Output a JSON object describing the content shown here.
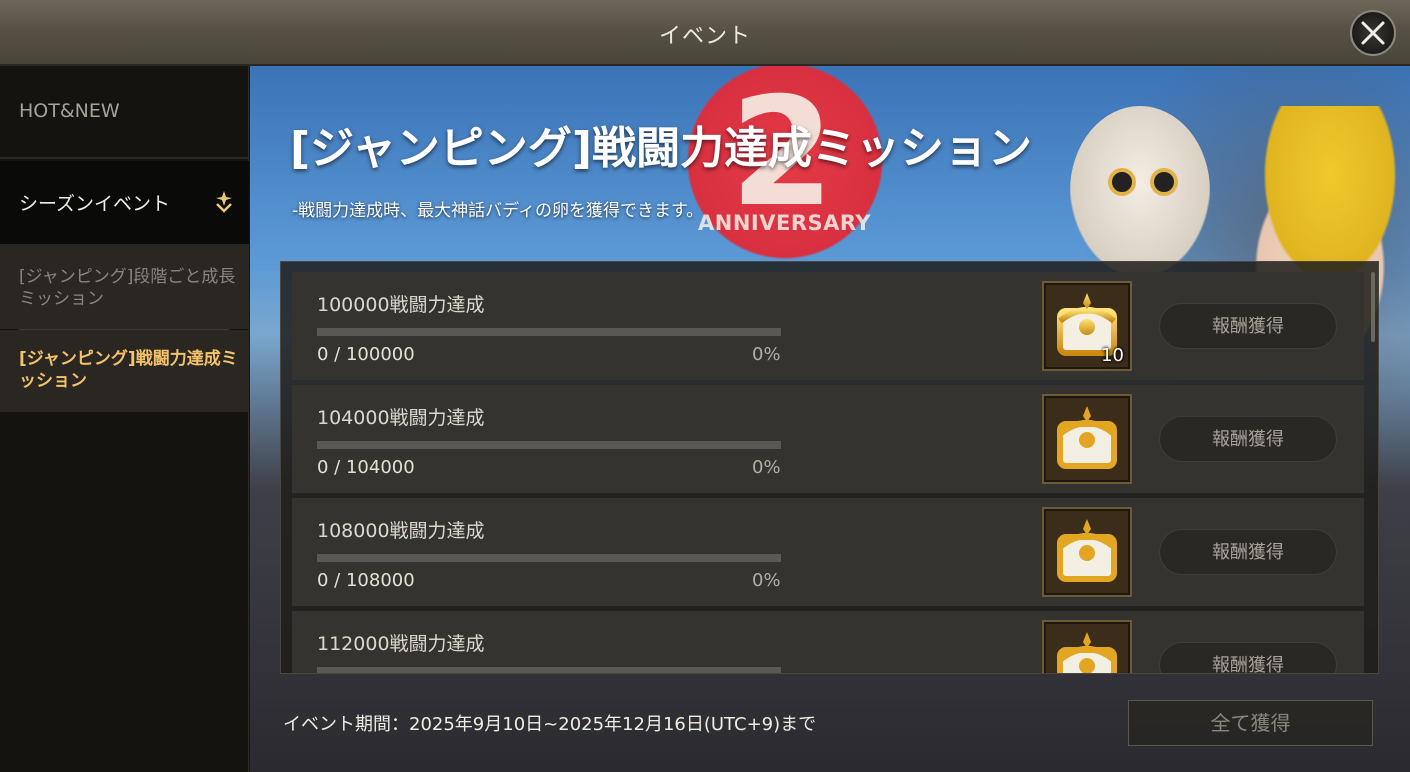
{
  "window": {
    "title": "イベント"
  },
  "sidebar": {
    "items": [
      {
        "label": "HOT&NEW"
      },
      {
        "label": "シーズンイベント"
      }
    ],
    "sub_items": [
      {
        "label": "[ジャンピング]段階ごと成長ミッション"
      },
      {
        "label": "[ジャンピング]戦闘力達成ミッション"
      }
    ]
  },
  "banner": {
    "big_number": "2",
    "anniversary_text": "ANNIVERSARY"
  },
  "main": {
    "title": "[ジャンピング]戦闘力達成ミッション",
    "subtitle": "-戦闘力達成時、最大神話バディの卵を獲得できます。"
  },
  "missions": [
    {
      "title": "100000戦闘力達成",
      "progress": "0 / 100000",
      "percent": "0%",
      "progress_value": 0,
      "reward_qty": "10",
      "button": "報酬獲得"
    },
    {
      "title": "104000戦闘力達成",
      "progress": "0 / 104000",
      "percent": "0%",
      "progress_value": 0,
      "reward_qty": "",
      "button": "報酬獲得"
    },
    {
      "title": "108000戦闘力達成",
      "progress": "0 / 108000",
      "percent": "0%",
      "progress_value": 0,
      "reward_qty": "",
      "button": "報酬獲得"
    },
    {
      "title": "112000戦闘力達成",
      "progress": "",
      "percent": "",
      "progress_value": 0,
      "reward_qty": "",
      "button": "報酬獲得"
    }
  ],
  "footer": {
    "period": "イベント期間：2025年9月10日~2025年12月16日(UTC+9)まで",
    "claim_all": "全て獲得"
  },
  "icons": {
    "close": "close-icon",
    "season_marker": "star-arrow-icon",
    "reward": "treasure-chest-icon"
  },
  "colors": {
    "accent": "#f3c26a",
    "selected_text": "#f1ede4"
  }
}
